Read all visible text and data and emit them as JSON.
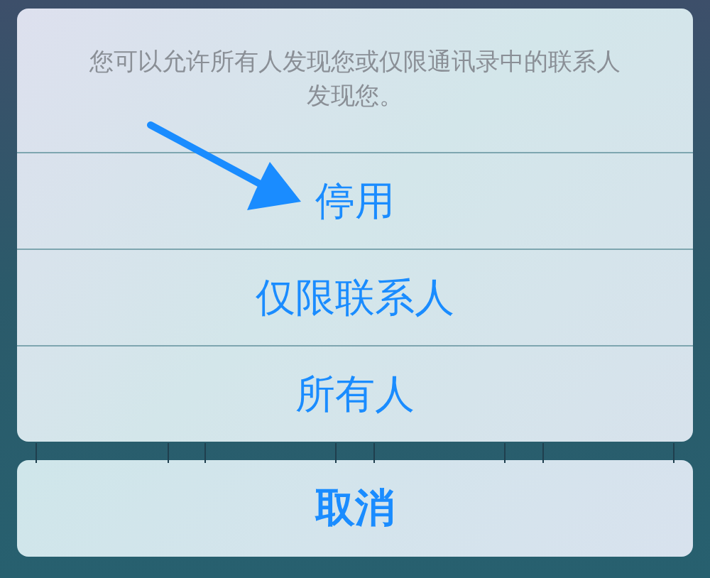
{
  "action_sheet": {
    "message": "您可以允许所有人发现您或仅限通讯录中的联系人发现您。",
    "options": [
      {
        "label": "停用"
      },
      {
        "label": "仅限联系人"
      },
      {
        "label": "所有人"
      }
    ],
    "cancel": "取消"
  },
  "annotation": {
    "kind": "arrow"
  }
}
